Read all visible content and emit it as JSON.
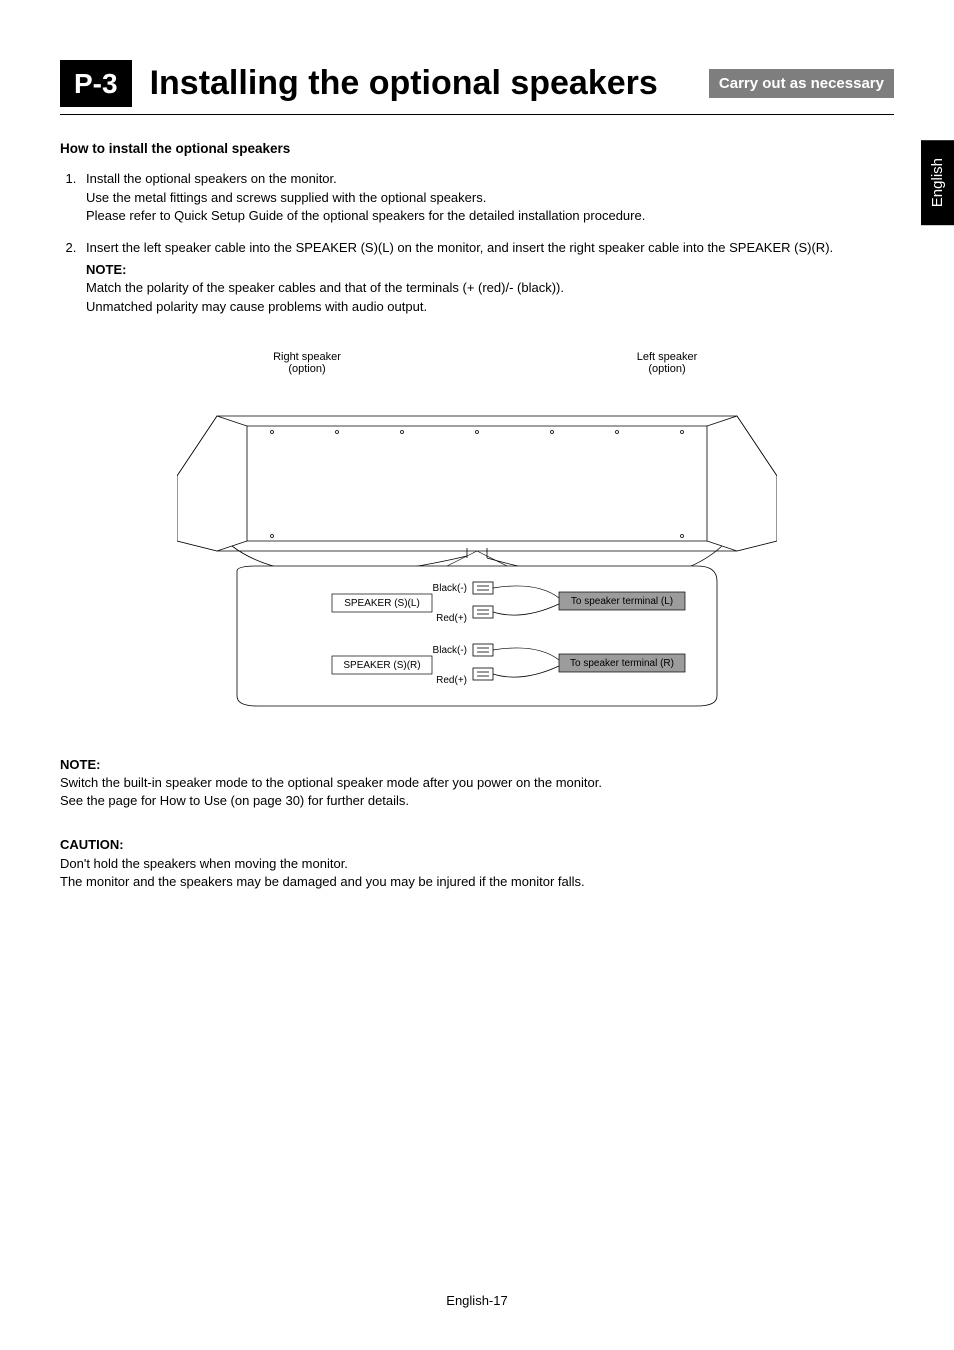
{
  "header": {
    "badge": "P-3",
    "title": "Installing the optional speakers",
    "tag": "Carry out as necessary"
  },
  "lang_tab": "English",
  "subheading": "How to install the optional speakers",
  "steps": [
    {
      "num": "1.",
      "lines": [
        "Install the optional speakers on the monitor.",
        "Use the metal fittings and screws supplied with the optional speakers.",
        "Please refer to Quick Setup Guide of the optional speakers for the detailed installation procedure."
      ]
    },
    {
      "num": "2.",
      "lines": [
        "Insert the left speaker cable into the SPEAKER (S)(L) on the monitor, and insert the right speaker cable into the SPEAKER (S)(R)."
      ],
      "note_label": "NOTE:",
      "note_lines": [
        "Match the polarity of the speaker cables and that of the terminals (+ (red)/- (black)).",
        "Unmatched polarity may cause problems with audio output."
      ]
    }
  ],
  "diagram": {
    "right_speaker_top": "Right speaker",
    "right_speaker_sub": "(option)",
    "left_speaker_top": "Left speaker",
    "left_speaker_sub": "(option)",
    "speaker_sl": "SPEAKER (S)(L)",
    "speaker_sr": "SPEAKER (S)(R)",
    "black_minus_1": "Black(-)",
    "red_plus_1": "Red(+)",
    "black_minus_2": "Black(-)",
    "red_plus_2": "Red(+)",
    "to_terminal_l": "To speaker terminal (L)",
    "to_terminal_r": "To speaker terminal (R)"
  },
  "note_block": {
    "label": "NOTE:",
    "lines": [
      "Switch the built-in speaker mode to the optional speaker mode after you power on the monitor.",
      "See the page for How to Use (on page 30) for further details."
    ]
  },
  "caution_block": {
    "label": "CAUTION:",
    "lines": [
      "Don't hold the speakers when moving the monitor.",
      "The monitor and the speakers may be damaged and you may be injured if the monitor falls."
    ]
  },
  "footer": "English-17"
}
